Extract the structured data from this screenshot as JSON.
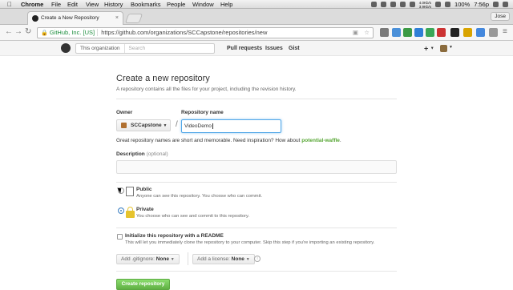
{
  "menubar": {
    "app": "Chrome",
    "items": [
      "File",
      "Edit",
      "View",
      "History",
      "Bookmarks",
      "People",
      "Window",
      "Help"
    ],
    "battery": "100%",
    "time": "7:56p",
    "net_up": "4.0Kb/s",
    "net_down": "3.9Kb/s"
  },
  "tab": {
    "title": "Create a New Repository",
    "close": "×"
  },
  "user_button": "Jose",
  "omnibox": {
    "ev": "GitHub, Inc. [US]",
    "url": "https://github.com/organizations/SCCapstone/repositories/new"
  },
  "github_header": {
    "scope_label": "This organization",
    "search_placeholder": "Search",
    "nav": [
      "Pull requests",
      "Issues",
      "Gist"
    ],
    "plus": "+"
  },
  "page": {
    "title": "Create a new repository",
    "subtitle": "A repository contains all the files for your project, including the revision history.",
    "owner_label": "Owner",
    "owner_value": "SCCapstone",
    "slash": "/",
    "repo_label": "Repository name",
    "repo_value": "VideoDemo",
    "hint_prefix": "Great repository names are short and memorable. Need inspiration? How about",
    "hint_suggestion": "potential-waffle",
    "hint_suffix": ".",
    "description_label": "Description",
    "description_optional": "(optional)",
    "description_value": "",
    "public_title": "Public",
    "public_desc": "Anyone can see this repository. You choose who can commit.",
    "private_title": "Private",
    "private_desc": "You choose who can see and commit to this repository.",
    "init_title": "Initialize this repository with a README",
    "init_desc": "This will let you immediately clone the repository to your computer. Skip this step if you're importing an existing repository.",
    "gitignore_label": "Add .gitignore:",
    "gitignore_value": "None",
    "license_label": "Add a license:",
    "license_value": "None",
    "info": "i",
    "create_button": "Create repository"
  },
  "colors": {
    "create_button": "#60b044",
    "focus": "#51a7e8",
    "suggestion": "#55a532",
    "lock": "#e6c32d"
  },
  "icons": [
    "apple-icon",
    "github-favicon",
    "lock-icon",
    "star-icon",
    "octocat-icon",
    "repo-icon",
    "private-lock-icon",
    "info-icon"
  ]
}
